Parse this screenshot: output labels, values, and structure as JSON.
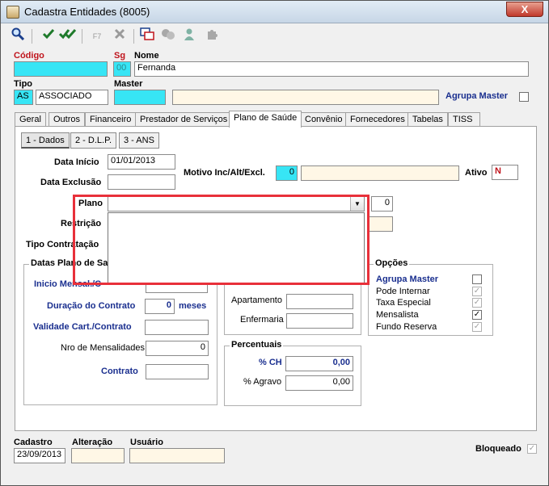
{
  "window": {
    "title": "Cadastra Entidades (8005)",
    "close_label": "X"
  },
  "toolbar": {
    "f7_label": "F7"
  },
  "header": {
    "codigo_label": "Código",
    "sg_label": "Sg",
    "sg_value": "00",
    "nome_label": "Nome",
    "nome_value": "Fernanda",
    "tipo_label": "Tipo",
    "tipo_code": "AS",
    "tipo_value": "ASSOCIADO",
    "master_label": "Master",
    "agrupa_master_label": "Agrupa Master"
  },
  "tabs": [
    "Geral",
    "Outros",
    "Financeiro",
    "Prestador de Serviços",
    "Plano de Saúde",
    "Convênio",
    "Fornecedores",
    "Tabelas",
    "TISS"
  ],
  "subtabs": [
    "1 - Dados",
    "2 - D.L.P.",
    "3 - ANS"
  ],
  "plano": {
    "data_inicio_label": "Data Início",
    "data_inicio_value": "01/01/2013",
    "data_exclusao_label": "Data Exclusão",
    "motivo_label": "Motivo Inc/Alt/Excl.",
    "motivo_value": "0",
    "ativo_label": "Ativo",
    "ativo_value": "N",
    "plano_label": "Plano",
    "plano_num": "0",
    "restricao_label": "Restrição",
    "tipo_contratacao_label": "Tipo Contratação"
  },
  "datas_group": {
    "title": "Datas Plano de Sa",
    "inicio_label": "Inicio Mensal./C",
    "duracao_label": "Duração do Contrato",
    "duracao_value": "0",
    "duracao_unit": "meses",
    "validade_label": "Validade Cart./Contrato",
    "nro_label": "Nro de Mensalidades",
    "nro_value": "0",
    "contrato_label": "Contrato"
  },
  "acomodacao": {
    "apartamento_label": "Apartamento",
    "enfermaria_label": "Enfermaria"
  },
  "percentuais": {
    "title": "Percentuais",
    "ch_label": "% CH",
    "ch_value": "0,00",
    "agravo_label": "% Agravo",
    "agravo_value": "0,00"
  },
  "opcoes": {
    "title": "Opções",
    "items": [
      {
        "label": "Agrupa Master",
        "checked": false
      },
      {
        "label": "Pode Internar",
        "checked": true
      },
      {
        "label": "Taxa Especial",
        "checked": true
      },
      {
        "label": "Mensalista",
        "checked": true
      },
      {
        "label": "Fundo Reserva",
        "checked": true
      }
    ]
  },
  "footer": {
    "cadastro_label": "Cadastro",
    "cadastro_value": "23/09/2013",
    "alteracao_label": "Alteração",
    "usuario_label": "Usuário",
    "bloqueado_label": "Bloqueado"
  },
  "colors": {
    "accent_cyan": "#37e5f5",
    "highlight_red": "#e8303a",
    "label_blue": "#1a2f8f",
    "label_red": "#c0141c"
  }
}
